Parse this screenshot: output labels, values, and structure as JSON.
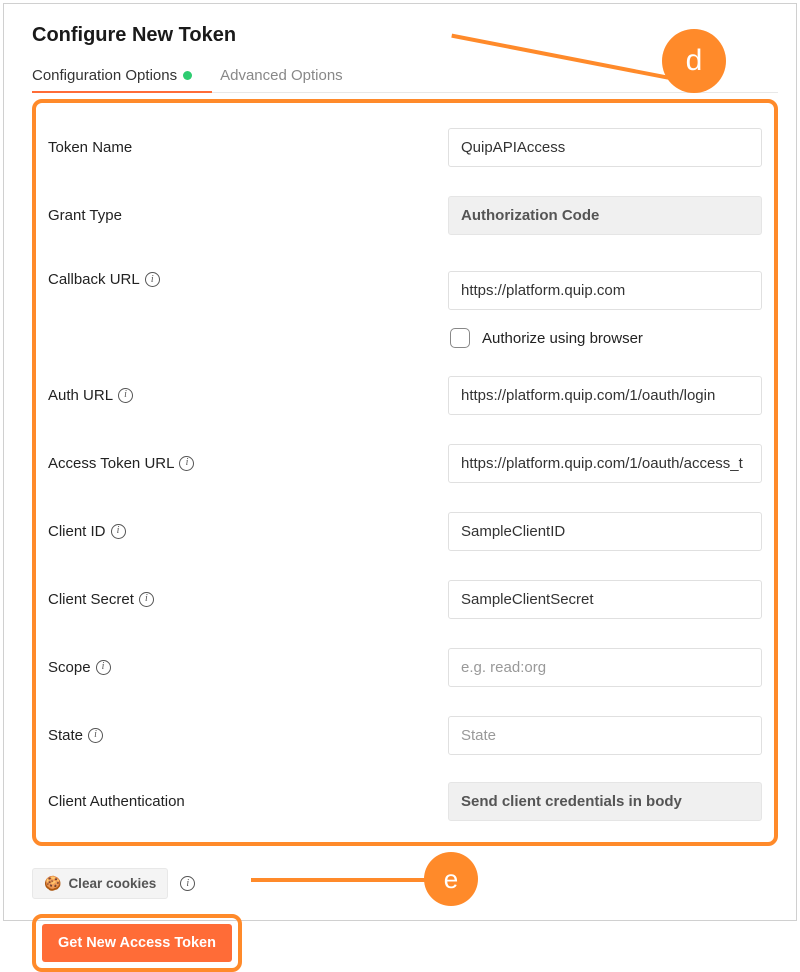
{
  "title": "Configure New Token",
  "tabs": {
    "config": "Configuration Options",
    "advanced": "Advanced Options"
  },
  "fields": {
    "token_name": {
      "label": "Token Name",
      "value": "QuipAPIAccess"
    },
    "grant_type": {
      "label": "Grant Type",
      "value": "Authorization Code"
    },
    "callback_url": {
      "label": "Callback URL",
      "value": "https://platform.quip.com"
    },
    "authorize_browser": {
      "label": "Authorize using browser"
    },
    "auth_url": {
      "label": "Auth URL",
      "value": "https://platform.quip.com/1/oauth/login"
    },
    "access_token_url": {
      "label": "Access Token URL",
      "value": "https://platform.quip.com/1/oauth/access_t"
    },
    "client_id": {
      "label": "Client ID",
      "value": "SampleClientID"
    },
    "client_secret": {
      "label": "Client Secret",
      "value": "SampleClientSecret"
    },
    "scope": {
      "label": "Scope",
      "placeholder": "e.g. read:org"
    },
    "state": {
      "label": "State",
      "placeholder": "State"
    },
    "client_auth": {
      "label": "Client Authentication",
      "value": "Send client credentials in body"
    }
  },
  "buttons": {
    "clear_cookies": "Clear cookies",
    "get_token": "Get New Access Token"
  },
  "callouts": {
    "d": "d",
    "e": "e"
  }
}
